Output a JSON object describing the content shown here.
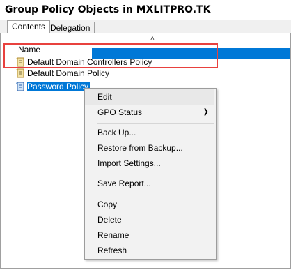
{
  "header": {
    "title": "Group Policy Objects in MXLITPRO.TK"
  },
  "tabs": [
    {
      "label": "Contents",
      "active": true
    },
    {
      "label": "Delegation",
      "active": false
    }
  ],
  "list": {
    "column_header": "Name",
    "items": [
      {
        "label": "Default Domain Controllers Policy",
        "selected": false,
        "icon": "gpo-icon"
      },
      {
        "label": "Default Domain Policy",
        "selected": false,
        "icon": "gpo-icon"
      },
      {
        "label": "Password Policy",
        "selected": true,
        "icon": "gpo-icon"
      }
    ]
  },
  "context_menu": {
    "items": [
      {
        "label": "Edit"
      },
      {
        "label": "GPO Status",
        "submenu": true
      },
      {
        "label": "Back Up..."
      },
      {
        "label": "Restore from Backup..."
      },
      {
        "label": "Import Settings..."
      },
      {
        "label": "Save Report..."
      },
      {
        "label": "Copy"
      },
      {
        "label": "Delete"
      },
      {
        "label": "Rename"
      },
      {
        "label": "Refresh"
      }
    ]
  },
  "colors": {
    "selection": "#0078d7",
    "highlight_box": "#e8413e",
    "menu_background": "#f2f2f2"
  }
}
